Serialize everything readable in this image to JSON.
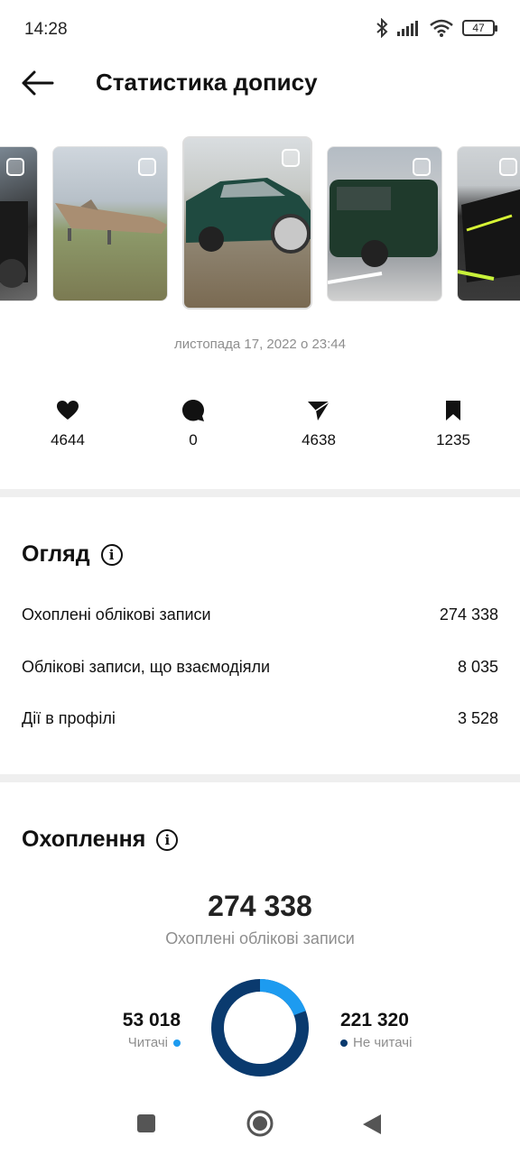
{
  "status_bar": {
    "time": "14:28",
    "battery": "47"
  },
  "header": {
    "title": "Статистика допису"
  },
  "post": {
    "date": "листопада 17, 2022 о 23:44"
  },
  "interactions": [
    {
      "icon": "heart-icon",
      "value": "4644"
    },
    {
      "icon": "comment-icon",
      "value": "0"
    },
    {
      "icon": "share-icon",
      "value": "4638"
    },
    {
      "icon": "bookmark-icon",
      "value": "1235"
    }
  ],
  "overview": {
    "title": "Огляд",
    "rows": [
      {
        "label": "Охоплені облікові записи",
        "value": "274 338"
      },
      {
        "label": "Облікові записи, що взаємодіяли",
        "value": "8 035"
      },
      {
        "label": "Дії в профілі",
        "value": "3 528"
      }
    ]
  },
  "reach": {
    "title": "Охоплення",
    "total": "274 338",
    "subtitle": "Охоплені облікові записи",
    "followers_value": "53 018",
    "followers_label": "Читачі",
    "followers_fraction": 0.193,
    "non_followers_value": "221 320",
    "non_followers_label": "Не читачі",
    "colors": {
      "followers": "#1d9bf0",
      "non_followers": "#0a3a6e"
    }
  }
}
